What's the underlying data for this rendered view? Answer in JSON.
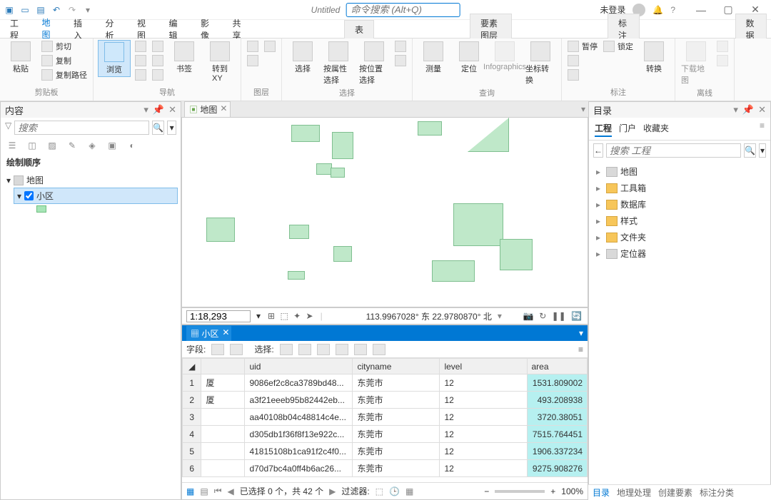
{
  "titlebar": {
    "title": "Untitled",
    "command_search_placeholder": "命令搜索 (Alt+Q)",
    "login_status": "未登录"
  },
  "ribbon": {
    "tabs": [
      "工程",
      "地图",
      "插入",
      "分析",
      "视图",
      "编辑",
      "影像",
      "共享"
    ],
    "active_tab_index": 1,
    "context_tabs": [
      "表",
      "要素图层",
      "标注",
      "数据"
    ],
    "groups": {
      "clipboard": {
        "label": "剪贴板",
        "paste": "粘贴",
        "cut": "剪切",
        "copy": "复制",
        "copy_path": "复制路径"
      },
      "navigate": {
        "label": "导航",
        "explore": "浏览",
        "bookmarks": "书签",
        "goto_xy": "转到\nXY"
      },
      "layer": {
        "label": "图层"
      },
      "selection": {
        "label": "选择",
        "select": "选择",
        "select_by_attr": "按属性选择",
        "select_by_loc": "按位置选择"
      },
      "inquiry": {
        "label": "查询",
        "measure": "测量",
        "locate": "定位",
        "infographics": "Infographics",
        "coord_convert": "坐标转换"
      },
      "labeling": {
        "label": "标注",
        "pause": "暂停",
        "lock": "锁定",
        "convert": "转换"
      },
      "offline": {
        "label": "离线",
        "download": "下载地图"
      }
    }
  },
  "contents": {
    "title": "内容",
    "search_placeholder": "搜索",
    "section_label": "绘制顺序",
    "items": [
      {
        "label": "地图",
        "is_map": true
      },
      {
        "label": "小区",
        "is_layer": true,
        "selected": true
      }
    ]
  },
  "map_view": {
    "tab_label": "地图",
    "scale": "1:18,293",
    "coords": "113.9967028° 东  22.9780870° 北"
  },
  "attribute_table": {
    "tab_label": "小区",
    "fields_label": "字段:",
    "selection_label": "选择:",
    "columns": [
      "",
      "uid",
      "cityname",
      "level",
      "area"
    ],
    "rows": [
      {
        "n": 1,
        "c0": "厦",
        "uid": "9086ef2c8ca3789bd48...",
        "cityname": "东莞市",
        "level": "12",
        "area": "1531.809002",
        "hl": true
      },
      {
        "n": 2,
        "c0": "厦",
        "uid": "a3f21eeeb95b82442eb...",
        "cityname": "东莞市",
        "level": "12",
        "area": "493.208938",
        "hl": true
      },
      {
        "n": 3,
        "c0": "",
        "uid": "aa40108b04c48814c4e...",
        "cityname": "东莞市",
        "level": "12",
        "area": "3720.38051",
        "hl": true
      },
      {
        "n": 4,
        "c0": "",
        "uid": "d305db1f36f8f13e922c...",
        "cityname": "东莞市",
        "level": "12",
        "area": "7515.764451",
        "hl": true
      },
      {
        "n": 5,
        "c0": "",
        "uid": "41815108b1ca91f2c4f0...",
        "cityname": "东莞市",
        "level": "12",
        "area": "1906.337234",
        "hl": true
      },
      {
        "n": 6,
        "c0": "",
        "uid": "d70d7bc4a0ff4b6ac26...",
        "cityname": "东莞市",
        "level": "12",
        "area": "9275.908276",
        "hl": true
      }
    ],
    "status": {
      "selection_text": "已选择 0 个，共 42 个",
      "filter_label": "过滤器:",
      "zoom": "100%"
    }
  },
  "catalog": {
    "title": "目录",
    "tabs": [
      "工程",
      "门户",
      "收藏夹"
    ],
    "active_tab": 0,
    "search_placeholder": "搜索 工程",
    "items": [
      "地图",
      "工具箱",
      "数据库",
      "样式",
      "文件夹",
      "定位器"
    ]
  },
  "bottom_tabs": [
    "目录",
    "地理处理",
    "创建要素",
    "标注分类"
  ]
}
